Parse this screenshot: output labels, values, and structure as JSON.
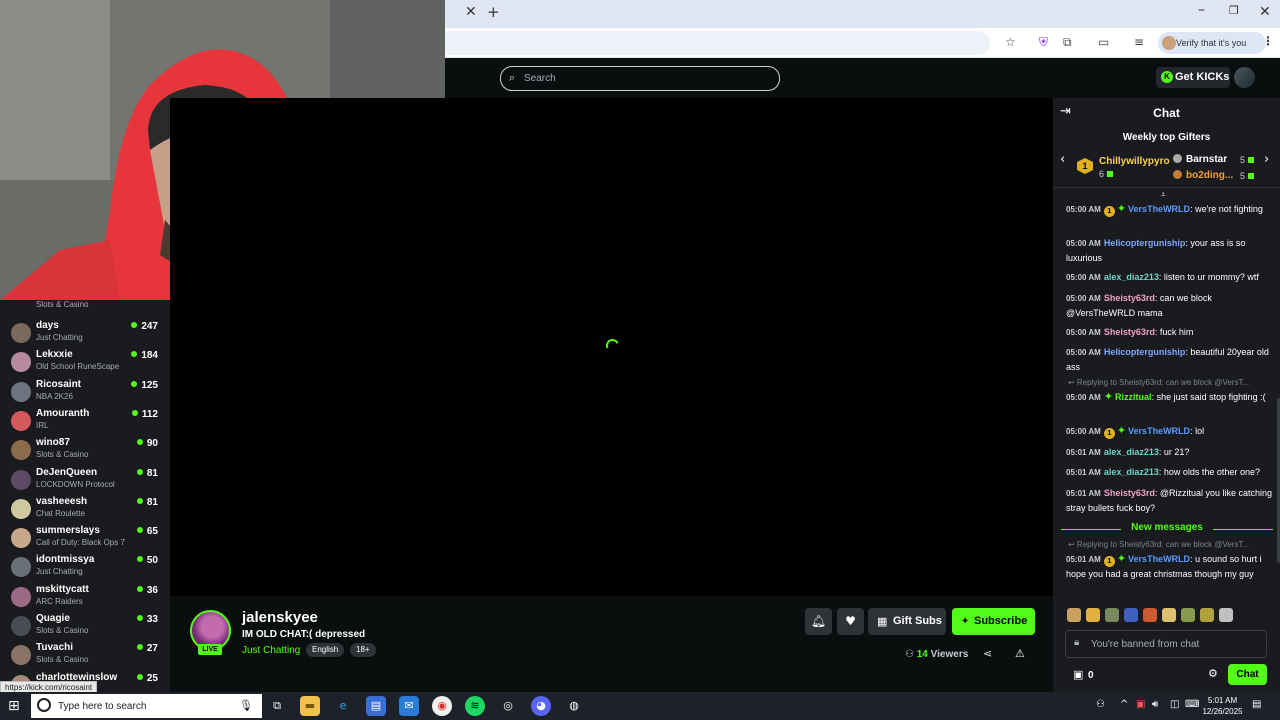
{
  "browser": {
    "tab_close": "✕",
    "new_tab": "+",
    "verify_label": "Verify that it's you"
  },
  "status_url": "https://kick.com/ricosaint",
  "header": {
    "search_placeholder": "Search",
    "get_kicks": "Get KICKs"
  },
  "sidebar": {
    "top_partial_category": "Slots & Casino",
    "items": [
      {
        "name": "days",
        "category": "Just Chatting",
        "viewers": "247",
        "color": "#7a6a5c"
      },
      {
        "name": "Lekxxie",
        "category": "Old School RuneScape",
        "viewers": "184",
        "color": "#b88aa0"
      },
      {
        "name": "Ricosaint",
        "category": "NBA 2K26",
        "viewers": "125",
        "color": "#6d7480"
      },
      {
        "name": "Amouranth",
        "category": "IRL",
        "viewers": "112",
        "color": "#d25a5a"
      },
      {
        "name": "wino87",
        "category": "Slots & Casino",
        "viewers": "90",
        "color": "#8c6a4c"
      },
      {
        "name": "DeJenQueen",
        "category": "LOCKDOWN Protocol",
        "viewers": "81",
        "color": "#5c4a66"
      },
      {
        "name": "vasheeesh",
        "category": "Chat Roulette",
        "viewers": "81",
        "color": "#cfc9a0"
      },
      {
        "name": "summerslays",
        "category": "Call of Duty: Black Ops 7",
        "viewers": "65",
        "color": "#c7a88a"
      },
      {
        "name": "idontmissya",
        "category": "Just Chatting",
        "viewers": "50",
        "color": "#6a7078"
      },
      {
        "name": "mskittycatt",
        "category": "ARC Raiders",
        "viewers": "36",
        "color": "#9a6a86"
      },
      {
        "name": "Quagie",
        "category": "Slots & Casino",
        "viewers": "33",
        "color": "#4a4e54"
      },
      {
        "name": "Tuvachi",
        "category": "Slots & Casino",
        "viewers": "27",
        "color": "#8a7466"
      },
      {
        "name": "charlottewinslow",
        "category": "",
        "viewers": "25",
        "color": "#a88a7a"
      }
    ]
  },
  "channel": {
    "live": "LIVE",
    "name": "jalenskyee",
    "title": "IM OLD CHAT:( depressed",
    "category": "Just Chatting",
    "tags": [
      "English",
      "18+"
    ],
    "gift_subs": "Gift Subs",
    "subscribe": "Subscribe",
    "viewer_count": "14",
    "viewers_label": "Viewers"
  },
  "chat": {
    "title": "Chat",
    "gifters_heading": "Weekly top Gifters",
    "gifter1": {
      "rank": "1",
      "name": "Chillywillypyro",
      "count": "6"
    },
    "gifter2": {
      "name": "Barnstar",
      "count": "5"
    },
    "gifter3": {
      "name": "bo2ding...",
      "count": "5"
    },
    "messages": [
      {
        "time": "05:00 AM",
        "user": "VersTheWRLD",
        "color": "#5b9bff",
        "text": "we're not fighting",
        "b1": "1",
        "b2": "✦"
      },
      {
        "time": "05:00 AM",
        "user": "Helicopterguniship",
        "color": "#7fa7ff",
        "text": "your ass is so luxurious"
      },
      {
        "time": "05:00 AM",
        "user": "alex_diaz213",
        "color": "#6fd3c6",
        "text": "listen to ur mommy? wtf"
      },
      {
        "time": "05:00 AM",
        "user": "Sheisty63rd",
        "color": "#f0a0c8",
        "text": "can we block @VersTheWRLD mama"
      },
      {
        "time": "05:00 AM",
        "user": "Sheisty63rd",
        "color": "#f0a0c8",
        "text": "fuck him"
      },
      {
        "time": "05:00 AM",
        "user": "Helicopterguniship",
        "color": "#7fa7ff",
        "text": "beautiful 20year old ass"
      },
      {
        "time": "05:00 AM",
        "user": "Rizzitual",
        "color": "#53fc18",
        "text": "she just said stop fighting :(",
        "b2": "✦"
      },
      {
        "time": "05:00 AM",
        "user": "VersTheWRLD",
        "color": "#5b9bff",
        "text": "lol",
        "b1": "1",
        "b2": "✦"
      },
      {
        "time": "05:01 AM",
        "user": "alex_diaz213",
        "color": "#6fd3c6",
        "text": "ur 21?"
      },
      {
        "time": "05:01 AM",
        "user": "alex_diaz213",
        "color": "#6fd3c6",
        "text": "how olds the other one?"
      },
      {
        "time": "05:01 AM",
        "user": "Sheisty63rd",
        "color": "#f0a0c8",
        "text": "@Rizzitual you like catching stray bullets fuck boy?"
      },
      {
        "time": "05:01 AM",
        "user": "VersTheWRLD",
        "color": "#5b9bff",
        "text": "u sound so hurt i hope you had a great christmas though my guy",
        "b1": "1",
        "b2": "✦"
      }
    ],
    "reply1": "↩ Replying to Sheisty63rd: can we block @VersT...",
    "reply2": "↩ Replying to Sheisty63rd: can we block @VersT...",
    "new_messages": "New messages",
    "banned_placeholder": "You're banned from chat",
    "points": "0",
    "chat_button": "Chat"
  },
  "taskbar": {
    "search_placeholder": "Type here to search",
    "time": "5:01 AM",
    "date": "12/26/2025"
  }
}
